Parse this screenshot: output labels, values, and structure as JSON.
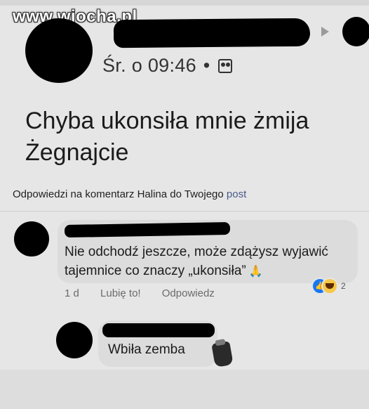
{
  "watermark": "www.wiocha.pl",
  "post": {
    "timestamp": "Śr. o 09:46",
    "separator": "•",
    "privacy_icon": "friends-icon",
    "text_line1": "Chyba ukonsiła mnie żmija",
    "text_line2": "Żegnajcie"
  },
  "reply_header": {
    "text": "Odpowiedzi na komentarz Halina do Twojego",
    "link": "post"
  },
  "comment1": {
    "line1": "Nie odchodź jeszcze, może zdążysz wyjawić",
    "line2": "tajemnice co znaczy „ukonsiła”",
    "emoji_icon": "folded-hands-icon",
    "age": "1 d",
    "like_label": "Lubię to!",
    "reply_label": "Odpowiedz",
    "reactions_icons": [
      "like-icon",
      "haha-icon"
    ],
    "reaction_count": "2"
  },
  "comment2": {
    "text": "Wbiła zemba",
    "sticker_icon": "jar-icon"
  },
  "colors": {
    "background": "#e6e6e6",
    "bubble": "#dcdcdc",
    "link": "#4a5a8a",
    "like_blue": "#1877f2",
    "haha_yellow": "#f7c846"
  }
}
